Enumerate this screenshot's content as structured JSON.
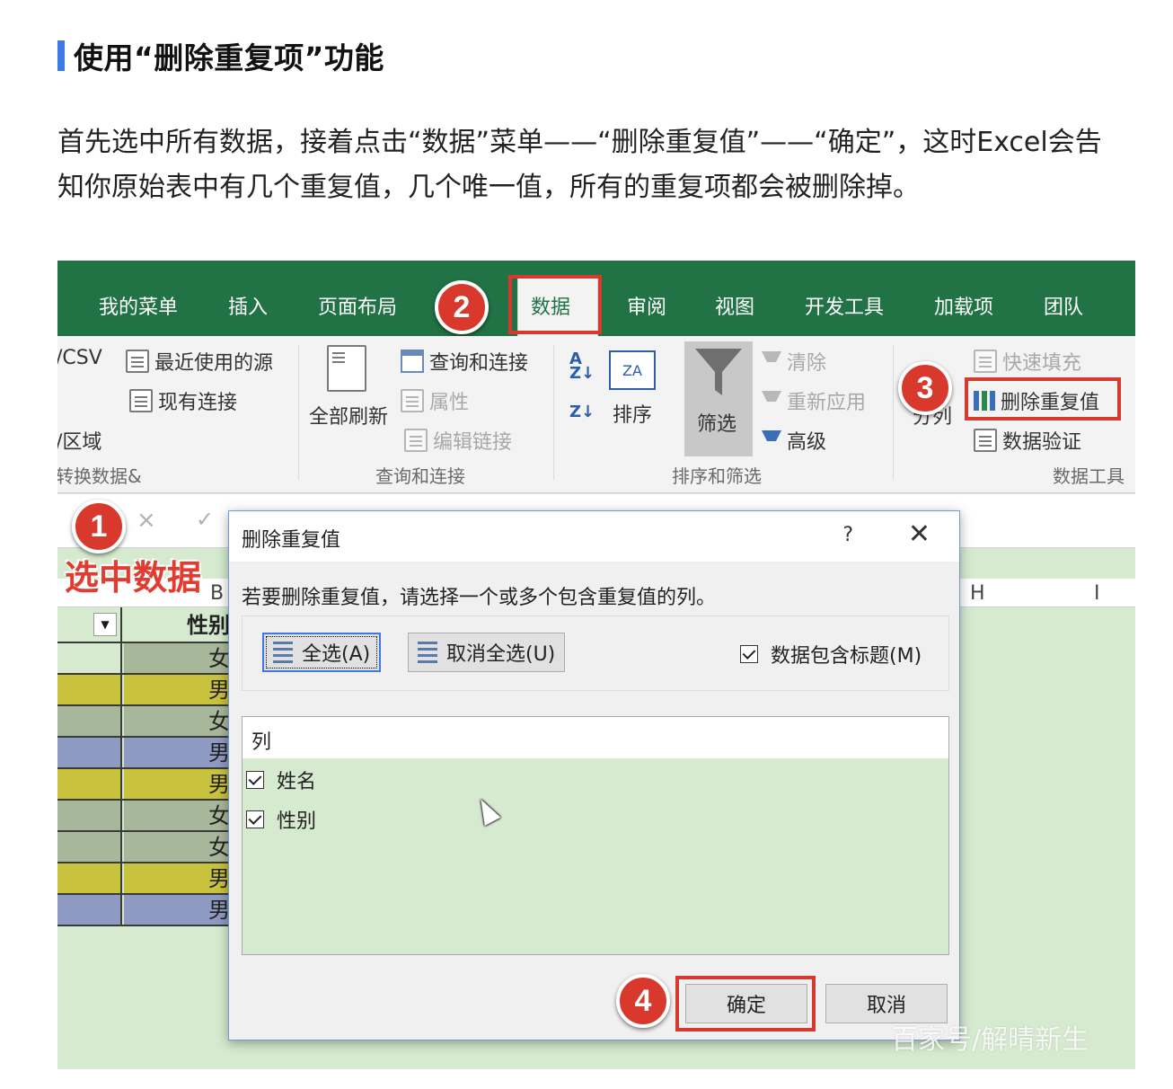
{
  "article": {
    "heading": "使用“删除重复项”功能",
    "paragraph_line1": "首先选中所有数据，接着点击“数据”菜单——“删除重复值”——“确定”，这时Excel会告",
    "paragraph_line2": "知你原始表中有几个重复值，几个唯一值，所有的重复项都会被删除掉。"
  },
  "menubar": {
    "items": [
      "我的菜单",
      "插入",
      "页面布局",
      "数据",
      "审阅",
      "视图",
      "开发工具",
      "加载项",
      "团队"
    ],
    "active": "数据",
    "color": "#217346"
  },
  "ribbon": {
    "get_transform": {
      "item1": "/CSV",
      "item2": "最近使用的源",
      "item3": "现有连接",
      "item4": "/区域",
      "group_label": "转换数据&"
    },
    "queries": {
      "refresh_all": "全部刷新",
      "item1": "查询和连接",
      "item2": "属性",
      "item3": "编辑链接",
      "group_label": "查询和连接"
    },
    "sort_filter": {
      "sort": "排序",
      "filter": "筛选",
      "clear": "清除",
      "reapply": "重新应用",
      "advanced": "高级",
      "group_label": "排序和筛选"
    },
    "data_tools": {
      "split": "分列",
      "flash_fill": "快速填充",
      "remove_duplicates": "删除重复值",
      "data_validation": "数据验证",
      "group_label": "数据工具"
    }
  },
  "annotations": {
    "badge1": "1",
    "badge2": "2",
    "badge3": "3",
    "badge4": "4",
    "select_data_label": "选中数据",
    "accent": "#d63a2f"
  },
  "sheet": {
    "col_b_header": "B",
    "col_h_header": "H",
    "col_i_header": "I",
    "header_cell": "性别",
    "formula_x": "×",
    "formula_check": "✓",
    "rows": [
      {
        "value": "女",
        "color": "#d6ead0",
        "color_b": "#a7b89a"
      },
      {
        "value": "男",
        "color": "#c9c23c",
        "color_b": "#c9c23c"
      },
      {
        "value": "女",
        "color": "#a7b89a",
        "color_b": "#a7b89a"
      },
      {
        "value": "男",
        "color": "#8e9ac2",
        "color_b": "#8e9ac2"
      },
      {
        "value": "男",
        "color": "#c9c23c",
        "color_b": "#c9c23c"
      },
      {
        "value": "女",
        "color": "#a7b89a",
        "color_b": "#a7b89a"
      },
      {
        "value": "女",
        "color": "#a7b89a",
        "color_b": "#a7b89a"
      },
      {
        "value": "男",
        "color": "#c9c23c",
        "color_b": "#c9c23c"
      },
      {
        "value": "男",
        "color": "#8e9ac2",
        "color_b": "#8e9ac2"
      }
    ]
  },
  "dialog": {
    "title": "删除重复值",
    "help": "?",
    "close": "✕",
    "instruction": "若要删除重复值，请选择一个或多个包含重复值的列。",
    "select_all": "全选(A)",
    "unselect_all": "取消全选(U)",
    "has_headers": "数据包含标题(M)",
    "list_header": "列",
    "columns": [
      "姓名",
      "性别"
    ],
    "ok": "确定",
    "cancel": "取消"
  },
  "watermark": "百家号/解晴新生"
}
